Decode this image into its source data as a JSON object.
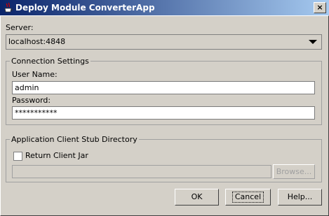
{
  "window": {
    "title": "Deploy Module ConverterApp",
    "close_glyph": "×"
  },
  "server": {
    "label": "Server:",
    "value": "localhost:4848"
  },
  "connection": {
    "title": "Connection Settings",
    "username_label": "User Name:",
    "username_value": "admin",
    "password_label": "Password:",
    "password_value": "***********"
  },
  "client_stub": {
    "title": "Application Client Stub Directory",
    "return_jar_label": "Return Client Jar",
    "browse_label": "Browse..."
  },
  "buttons": {
    "ok": "OK",
    "cancel": "Cancel",
    "help": "Help..."
  },
  "colors": {
    "dialog_bg": "#d4d0c8",
    "title_start": "#0a246a",
    "title_end": "#a6caf0"
  }
}
